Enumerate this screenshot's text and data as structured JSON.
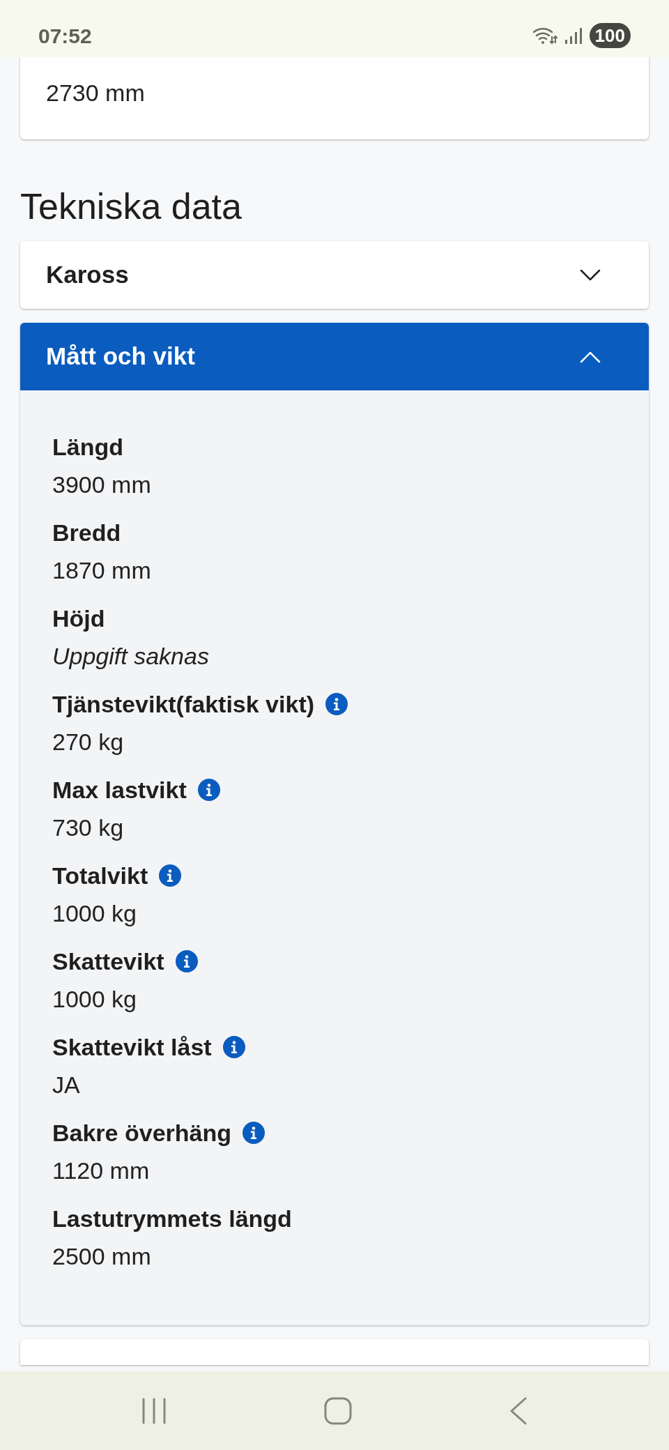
{
  "status_bar": {
    "time": "07:52",
    "battery": "100"
  },
  "top_card": {
    "value": "2730 mm"
  },
  "heading": "Tekniska data",
  "sections": [
    {
      "title": "Kaross",
      "expanded": false
    },
    {
      "title": "Mått och vikt",
      "expanded": true,
      "items": [
        {
          "label": "Längd",
          "info": false,
          "kind": "value",
          "value": "3900 mm"
        },
        {
          "label": "Bredd",
          "info": false,
          "kind": "value",
          "value": "1870 mm"
        },
        {
          "label": "Höjd",
          "info": false,
          "kind": "missing",
          "value": "Uppgift saknas"
        },
        {
          "label": "Tjänstevikt(faktisk vikt)",
          "info": true,
          "kind": "value",
          "value": "270 kg"
        },
        {
          "label": "Max lastvikt",
          "info": true,
          "kind": "value",
          "value": "730 kg"
        },
        {
          "label": "Totalvikt",
          "info": true,
          "kind": "value",
          "value": "1000 kg"
        },
        {
          "label": "Skattevikt",
          "info": true,
          "kind": "value",
          "value": "1000 kg"
        },
        {
          "label": "Skattevikt låst",
          "info": true,
          "kind": "value",
          "value": "JA"
        },
        {
          "label": "Bakre överhäng",
          "info": true,
          "kind": "value",
          "value": "1120 mm"
        },
        {
          "label": "Lastutrymmets längd",
          "info": false,
          "kind": "value",
          "value": "2500 mm"
        }
      ]
    }
  ]
}
